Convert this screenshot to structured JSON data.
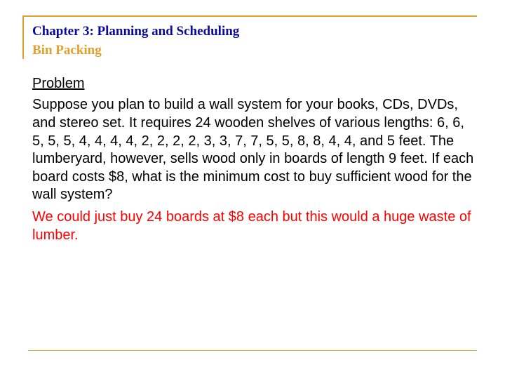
{
  "header": {
    "chapter_title": "Chapter 3:  Planning and Scheduling",
    "subtitle": "Bin Packing"
  },
  "content": {
    "section_head": "Problem",
    "body": "Suppose you plan to build a wall system for your books, CDs, DVDs, and stereo set.  It requires 24 wooden shelves of various lengths: 6, 6, 5, 5, 5, 4, 4, 4, 4, 2, 2, 2, 2, 3, 3, 7, 7, 5, 5, 8, 8, 4, 4, and 5 feet.  The lumberyard, however, sells wood only in boards of length 9 feet.  If each board costs $8, what is the minimum cost to buy sufficient wood for the wall system?",
    "highlight": "We could just buy 24 boards at $8 each but this would a huge waste of lumber."
  }
}
